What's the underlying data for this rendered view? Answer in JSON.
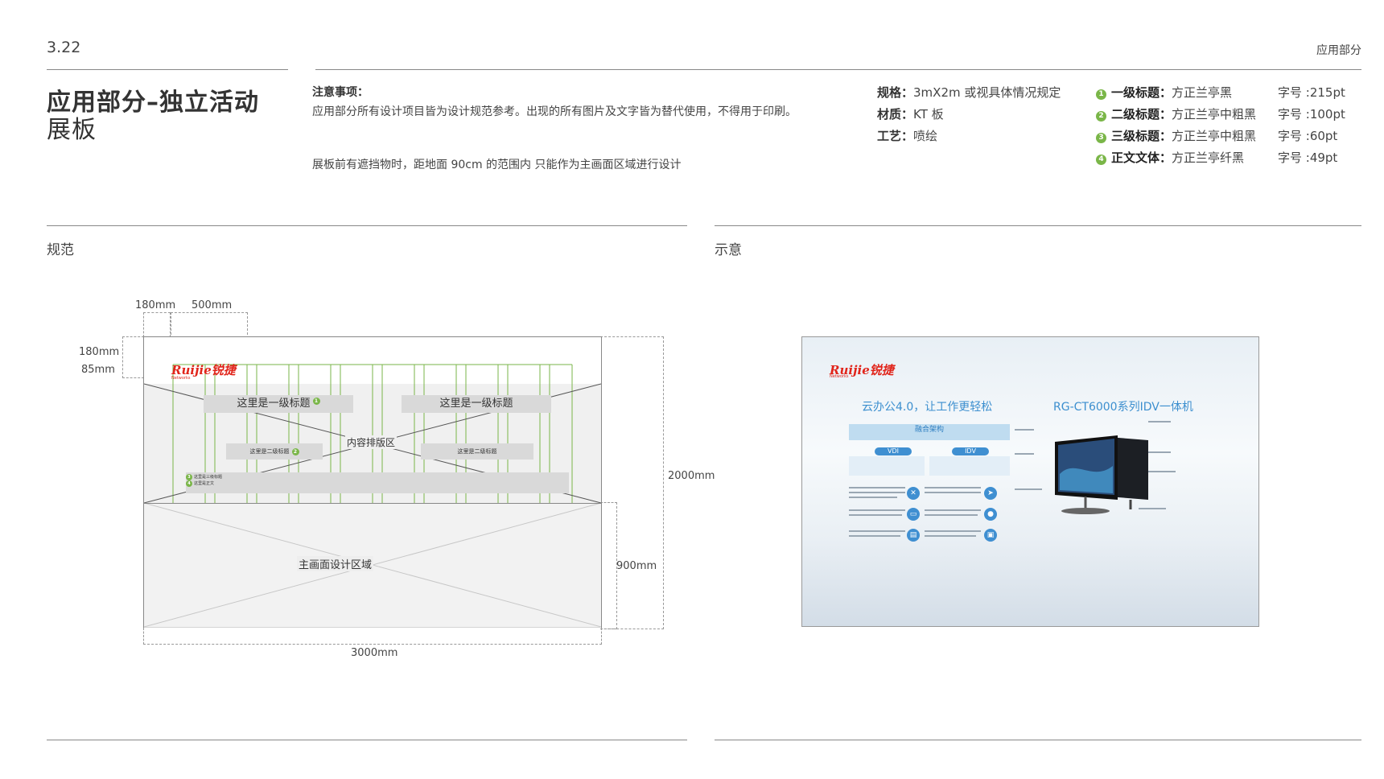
{
  "header": {
    "page_number": "3.22",
    "section": "应用部分",
    "title_line1": "应用部分–独立活动",
    "title_line2": "展板"
  },
  "notice": {
    "heading": "注意事项：",
    "body": "应用部分所有设计项目皆为设计规范参考。出现的所有图片及文字皆为替代使用，不得用于印刷。",
    "extra": "展板前有遮挡物时，距地面 90cm 的范围内 只能作为主画面区域进行设计"
  },
  "specs": [
    {
      "label": "规格：",
      "value": "3mX2m 或视具体情况规定"
    },
    {
      "label": "材质：",
      "value": "KT 板"
    },
    {
      "label": "工艺：",
      "value": "喷绘"
    }
  ],
  "fonts": [
    {
      "num": "1",
      "label": "一级标题：",
      "font": "方正兰亭黑",
      "size": "字号 :215pt"
    },
    {
      "num": "2",
      "label": "二级标题：",
      "font": "方正兰亭中粗黑",
      "size": "字号 :100pt"
    },
    {
      "num": "3",
      "label": "三级标题：",
      "font": "方正兰亭中粗黑",
      "size": "字号 :60pt"
    },
    {
      "num": "4",
      "label": "正文文体：",
      "font": "方正兰亭纤黑",
      "size": "字号 :49pt"
    }
  ],
  "spec_section": {
    "heading": "规范",
    "dim_top_a": "180mm",
    "dim_top_b": "500mm",
    "dim_left_a": "180mm",
    "dim_left_b": "85mm",
    "dim_height": "2000mm",
    "dim_lower": "900mm",
    "dim_width": "3000mm",
    "logo_text": "Ruijie锐捷",
    "logo_sub": "Networks",
    "title_left": "这里是一级标题",
    "title_right": "这里是一级标题",
    "content_area": "内容排版区",
    "sub_left": "这里是二级标题",
    "sub_right": "这里是二级标题",
    "body_l1": "这里是三级标题",
    "body_l2": "这里是正文",
    "main_area": "主画面设计区域",
    "marker_1": "1",
    "marker_2": "2",
    "marker_3": "3",
    "marker_4": "4"
  },
  "demo_section": {
    "heading": "示意",
    "logo_text": "Ruijie锐捷",
    "logo_sub": "Networks",
    "title_left": "云办公4.0，让工作更轻松",
    "title_right": "RG-CT6000系列IDV一体机",
    "band_title": "融合架构",
    "pill_vdi": "VDI",
    "pill_idv": "IDV"
  },
  "colors": {
    "accent_green": "#7ab648",
    "brand_red": "#e1251b",
    "demo_blue": "#3c8fcf",
    "placeholder_grey": "#d9d9d9"
  }
}
